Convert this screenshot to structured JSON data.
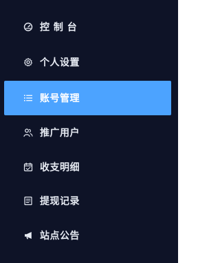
{
  "colors": {
    "sidebar_bg": "#0e1327",
    "text": "#e7ebf3",
    "active_bg": "#4ca3ff",
    "active_text": "#ffffff"
  },
  "sidebar": {
    "items": [
      {
        "label": "控 制 台",
        "icon": "dashboard-gauge-icon",
        "active": false
      },
      {
        "label": "个人设置",
        "icon": "gear-icon",
        "active": false
      },
      {
        "label": "账号管理",
        "icon": "list-icon",
        "active": true
      },
      {
        "label": "推广用户",
        "icon": "users-icon",
        "active": false
      },
      {
        "label": "收支明细",
        "icon": "calendar-icon",
        "active": false
      },
      {
        "label": "提现记录",
        "icon": "document-icon",
        "active": false
      },
      {
        "label": "站点公告",
        "icon": "megaphone-icon",
        "active": false
      }
    ]
  }
}
